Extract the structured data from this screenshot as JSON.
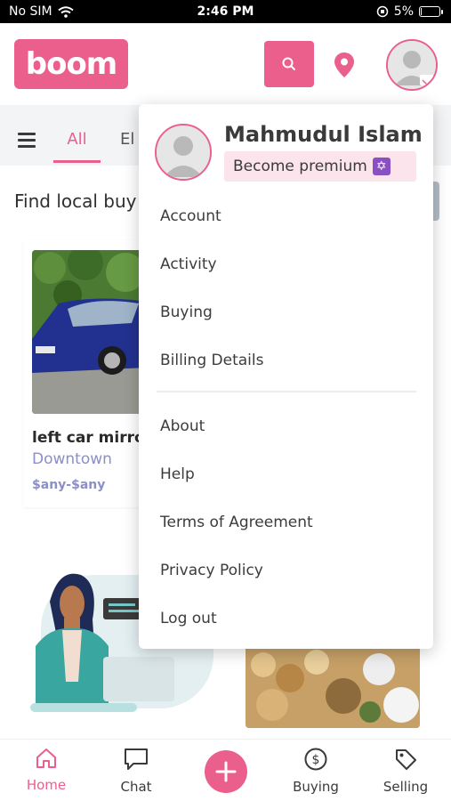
{
  "status_bar": {
    "carrier": "No SIM",
    "time": "2:46 PM",
    "battery_percent": "5%",
    "battery_level": 0.05
  },
  "header": {
    "logo_text": "boom"
  },
  "tabs": {
    "all_label": "All",
    "next_label_partial": "El"
  },
  "section": {
    "title": "Find local buy"
  },
  "listing": {
    "title": "left car mirror",
    "location": "Downtown",
    "price": "$any-$any"
  },
  "menu": {
    "user_name": "Mahmudul Islam",
    "premium_label": "Become premium",
    "items_group1": [
      "Account",
      "Activity",
      "Buying",
      "Billing Details"
    ],
    "items_group2": [
      "About",
      "Help",
      "Terms of Agreement",
      "Privacy Policy",
      "Log out"
    ]
  },
  "bottom_nav": {
    "home": "Home",
    "chat": "Chat",
    "buying": "Buying",
    "selling": "Selling"
  },
  "colors": {
    "accent": "#ea5f8c",
    "muted_blue": "#8c8fc6",
    "premium_bg": "#fbe4ec"
  }
}
